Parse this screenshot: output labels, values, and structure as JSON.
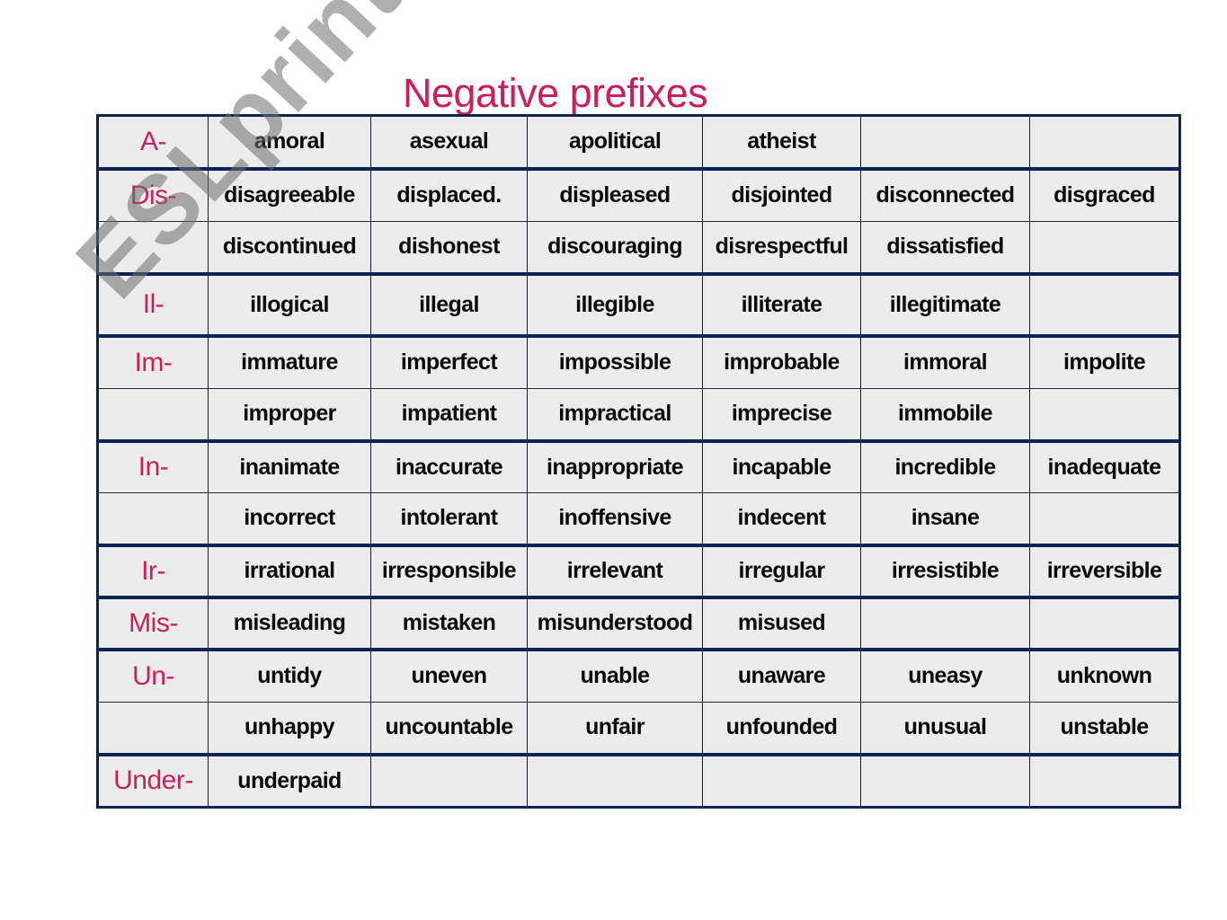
{
  "title": "Negative prefixes",
  "watermark": "ESLprintables.com",
  "colors": {
    "title": "#c81f5d",
    "prefix": "#c81f5d",
    "border": "#0c2451",
    "cell_background": "#ececec",
    "word_text": "#0a0a0a"
  },
  "table": {
    "rows": [
      {
        "prefix": "A-",
        "group_start": true,
        "words": [
          "amoral",
          "asexual",
          "apolitical",
          "atheist",
          "",
          ""
        ]
      },
      {
        "prefix": "Dis-",
        "group_start": true,
        "words": [
          "disagreeable",
          "displaced.",
          "displeased",
          "disjointed",
          "disconnected",
          "disgraced"
        ]
      },
      {
        "prefix": "",
        "group_start": false,
        "words": [
          "discontinued",
          "dishonest",
          "discouraging",
          "disrespectful",
          "dissatisfied",
          ""
        ]
      },
      {
        "prefix": "Il-",
        "group_start": true,
        "words": [
          "illogical",
          "illegal",
          "illegible",
          "illiterate",
          "illegitimate",
          ""
        ]
      },
      {
        "prefix": "Im-",
        "group_start": true,
        "words": [
          "immature",
          "imperfect",
          "impossible",
          "improbable",
          "immoral",
          "impolite"
        ]
      },
      {
        "prefix": "",
        "group_start": false,
        "words": [
          "improper",
          "impatient",
          "impractical",
          "imprecise",
          "immobile",
          ""
        ]
      },
      {
        "prefix": "In-",
        "group_start": true,
        "words": [
          "inanimate",
          "inaccurate",
          "inappropriate",
          "incapable",
          "incredible",
          "inadequate"
        ]
      },
      {
        "prefix": "",
        "group_start": false,
        "words": [
          "incorrect",
          "intolerant",
          "inoffensive",
          "indecent",
          "insane",
          ""
        ]
      },
      {
        "prefix": "Ir-",
        "group_start": true,
        "words": [
          "irrational",
          "irresponsible",
          "irrelevant",
          "irregular",
          "irresistible",
          "irreversible"
        ]
      },
      {
        "prefix": "Mis-",
        "group_start": true,
        "words": [
          "misleading",
          "mistaken",
          "misunderstood",
          "misused",
          "",
          ""
        ]
      },
      {
        "prefix": "Un-",
        "group_start": true,
        "words": [
          "untidy",
          "uneven",
          "unable",
          "unaware",
          "uneasy",
          "unknown"
        ]
      },
      {
        "prefix": "",
        "group_start": false,
        "words": [
          "unhappy",
          "uncountable",
          "unfair",
          "unfounded",
          "unusual",
          "unstable"
        ]
      },
      {
        "prefix": "Under-",
        "group_start": true,
        "words": [
          "underpaid",
          "",
          "",
          "",
          "",
          ""
        ]
      }
    ]
  }
}
